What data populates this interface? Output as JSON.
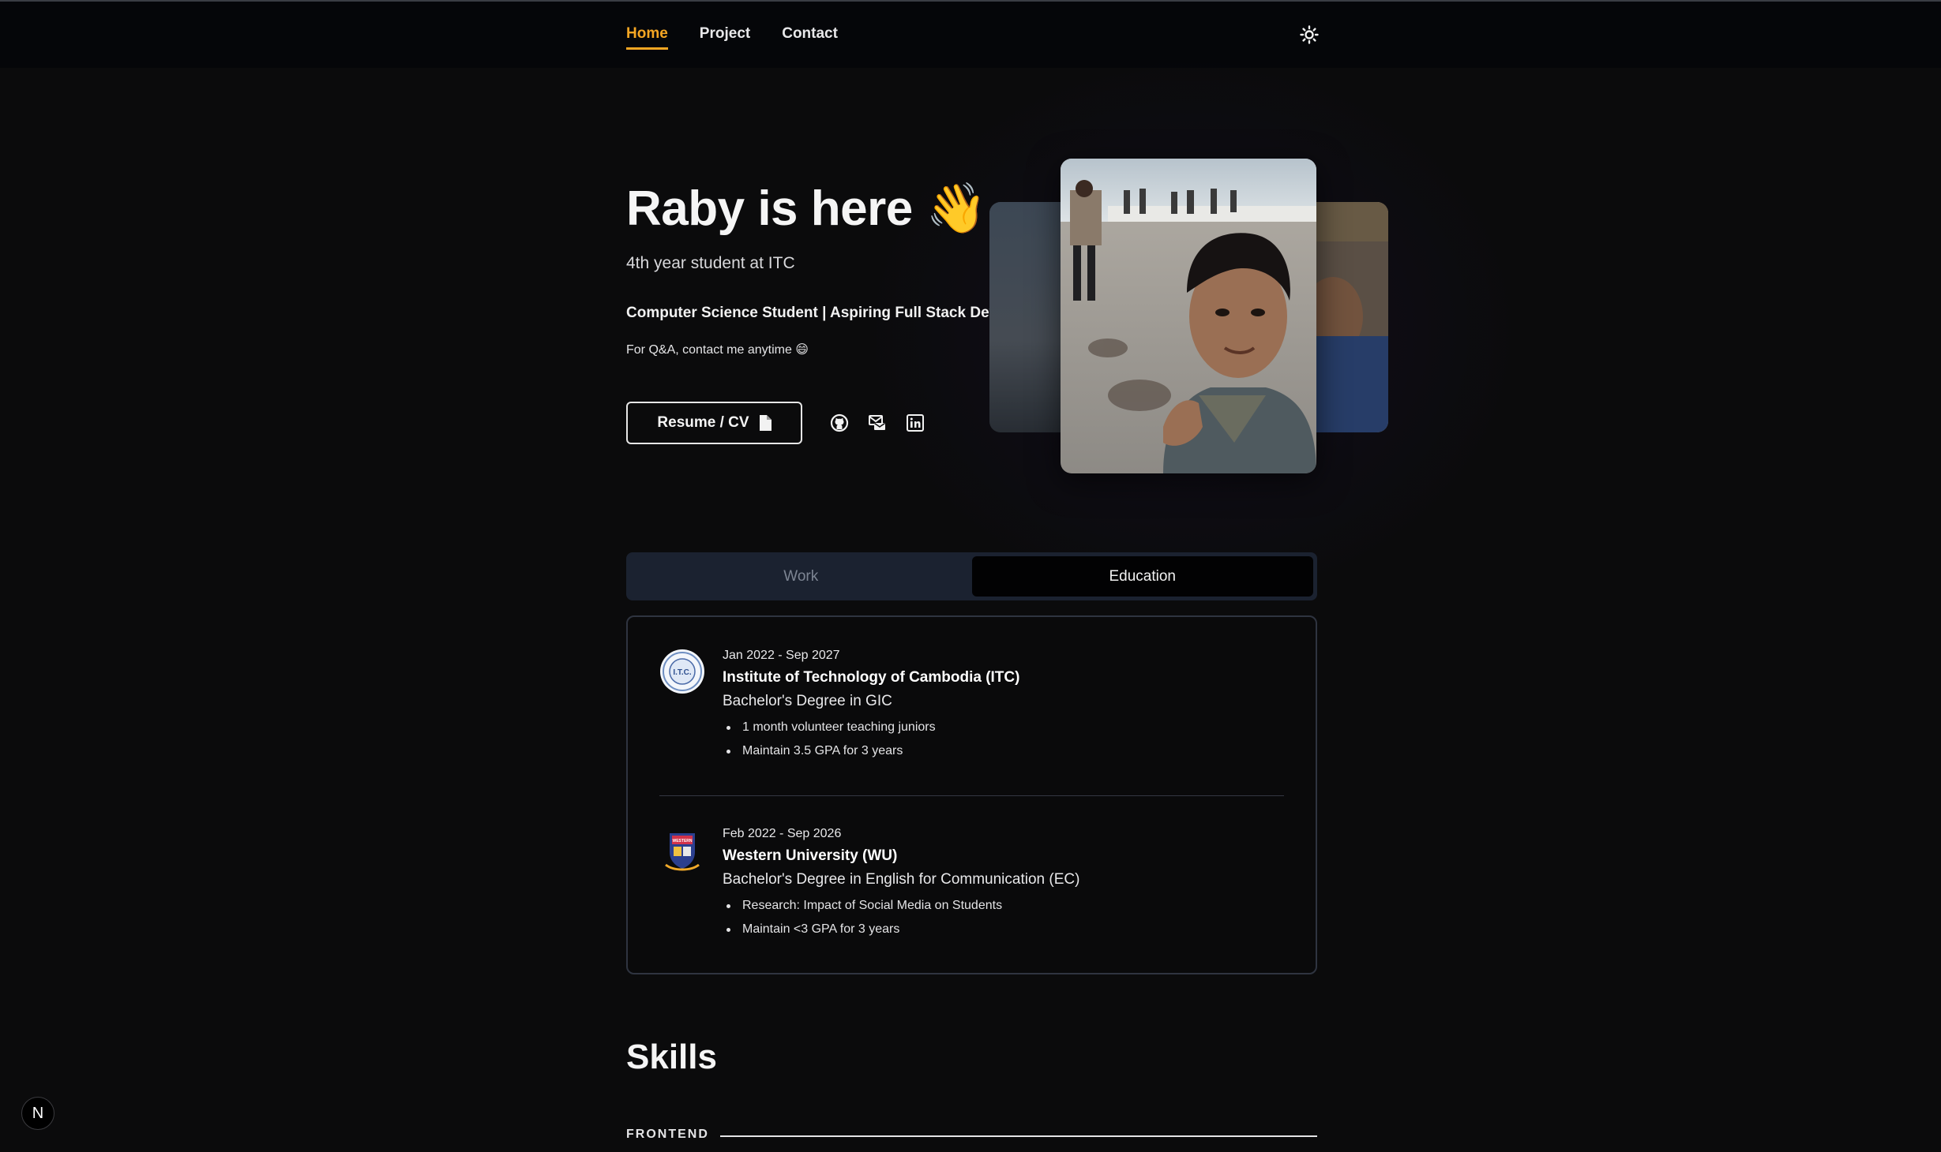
{
  "nav": {
    "items": [
      {
        "label": "Home",
        "active": true
      },
      {
        "label": "Project",
        "active": false
      },
      {
        "label": "Contact",
        "active": false
      }
    ],
    "accent_color": "#f6a623",
    "theme_toggle_icon": "sun-icon"
  },
  "hero": {
    "title": "Raby is here",
    "title_emoji": "👋",
    "subtitle": "4th year student at ITC",
    "role": "Computer Science Student | Aspiring Full Stack Developer",
    "qa": "For Q&A, contact me anytime 😄",
    "resume_label": "Resume / CV",
    "social_icons": [
      "github-icon",
      "email-icon",
      "linkedin-icon"
    ]
  },
  "tabs": [
    {
      "label": "Work",
      "active": false
    },
    {
      "label": "Education",
      "active": true
    }
  ],
  "education": [
    {
      "dates": "Jan 2022 - Sep 2027",
      "school": "Institute of Technology of Cambodia (ITC)",
      "degree": "Bachelor's Degree in GIC",
      "bullets": [
        "1 month volunteer teaching juniors",
        "Maintain 3.5 GPA for 3 years"
      ],
      "logo_text": "I.T.C."
    },
    {
      "dates": "Feb 2022 - Sep 2026",
      "school": "Western University (WU)",
      "degree": "Bachelor's Degree in English for Communication (EC)",
      "bullets": [
        "Research: Impact of Social Media on Students",
        "Maintain <3 GPA for 3 years"
      ],
      "logo_text": "WESTERN"
    }
  ],
  "skills": {
    "title": "Skills",
    "category": "FRONTEND"
  },
  "badge": {
    "label": "N"
  }
}
